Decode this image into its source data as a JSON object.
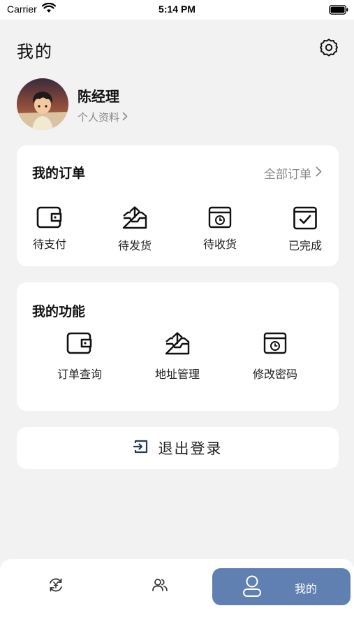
{
  "status_bar": {
    "carrier": "Carrier",
    "time": "5:14 PM"
  },
  "header": {
    "title": "我的"
  },
  "profile": {
    "name": "陈经理",
    "link_label": "个人资料"
  },
  "orders": {
    "title": "我的订单",
    "all_label": "全部订单",
    "items": [
      {
        "label": "待支付",
        "icon": "wallet-icon"
      },
      {
        "label": "待发货",
        "icon": "box-upload-icon"
      },
      {
        "label": "待收货",
        "icon": "box-clock-icon"
      },
      {
        "label": "已完成",
        "icon": "calendar-check-icon"
      }
    ]
  },
  "functions": {
    "title": "我的功能",
    "items": [
      {
        "label": "订单查询",
        "icon": "wallet-icon"
      },
      {
        "label": "地址管理",
        "icon": "box-upload-icon"
      },
      {
        "label": "修改密码",
        "icon": "box-clock-icon"
      }
    ]
  },
  "logout": {
    "label": "退出登录",
    "icon": "logout-icon"
  },
  "tab_bar": {
    "items": [
      {
        "icon": "refresh-yuan-icon"
      },
      {
        "icon": "users-icon"
      },
      {
        "icon": "user-icon",
        "label": "我的",
        "active": true
      }
    ],
    "active_color": "#5f80b0"
  },
  "colors": {
    "background": "#f2f2f2",
    "card": "#ffffff",
    "accent": "#5f80b0",
    "muted_text": "#8a8a8a"
  }
}
